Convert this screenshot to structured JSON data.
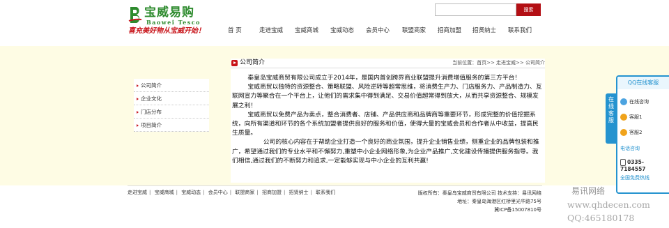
{
  "logo": {
    "brand": "宝威易购",
    "brand_en": "Baowei Tesco",
    "slogan": "喜充美好物从宝威开始！"
  },
  "search": {
    "placeholder": "",
    "button_label": "搜索"
  },
  "nav": {
    "items": [
      "首  页",
      "走进宝威",
      "宝威商城",
      "宝威动态",
      "会员中心",
      "联盟商家",
      "招商加盟",
      "招贤纳士",
      "联系我们"
    ]
  },
  "sidebar": {
    "items": [
      "公司简介",
      "企业文化",
      "门店分布",
      "项目简介"
    ]
  },
  "main": {
    "title": "公司简介",
    "breadcrumb": "当前位置：首页>> 走进宝威>> 公司简介",
    "paragraphs": [
      "        秦皇岛宝威商贸有限公司成立于2014年，是国内首创跨界商业联盟提升消费增值服务的第三方平台！",
      "        宝威商贸以独特的资源整合、策略联盟、风险逆转等超常思维，将消费生产力、门店服务力、产品制造力、互联网宣力等聚合在一个平台上，让他们的需求集中得到满足、交易价值超常得到放大，从而共享资源整合、规模发展之利！",
      "        宝威商贸以免费产品为卖点，整合消费者、店铺、产品供应商和品牌商等重要环节，形成完整的价值挖掘系统，向所有渠道和环节的各个系统加盟者提供良好的服务和价值，使得大量的宝威会员和合作者从中收益，提高民生质量。",
      "                公司的核心内容在于帮助企业打造一个良好的商业氛围，提升企业销售业绩，侧重企业的品牌包装和推广，希望通过我们的专业水平和不懈努力,重塑中小企业网络形象,为企业产品推广,文化建设传播提供服务指导。我们相信,通过我们的不断努力和追求,一定能够实现与中小企业的互利共赢!"
    ]
  },
  "footer": {
    "links": [
      "走进宝威",
      "宝威商城",
      "宝威动态",
      "会员中心",
      "联盟商家",
      "招商加盟",
      "招贤纳士",
      "联系我们"
    ],
    "separator": "|",
    "copyright": "版权所有：秦皇岛宝威商贸有限公司 技术支持：易讯网络",
    "address": "地址：秦皇岛海港区红桥里光华路75号",
    "icp": "冀ICP备15007810号"
  },
  "cs_panel": {
    "tab_label": "在线客服",
    "header": "QQ在线客服",
    "online": "在线咨询",
    "agent1": "客服1",
    "agent2": "客服2",
    "phone_header": "电话咨询",
    "phone": "0335-7184557",
    "free_header": "全国免费热线",
    "colors": {
      "accent": "#2593cf",
      "brand_red": "#c8141a",
      "band": "#fefce4"
    }
  },
  "watermark": {
    "line1": "易讯网络",
    "line2": "www.qhdecen.com",
    "line3": "QQ:465180178"
  }
}
